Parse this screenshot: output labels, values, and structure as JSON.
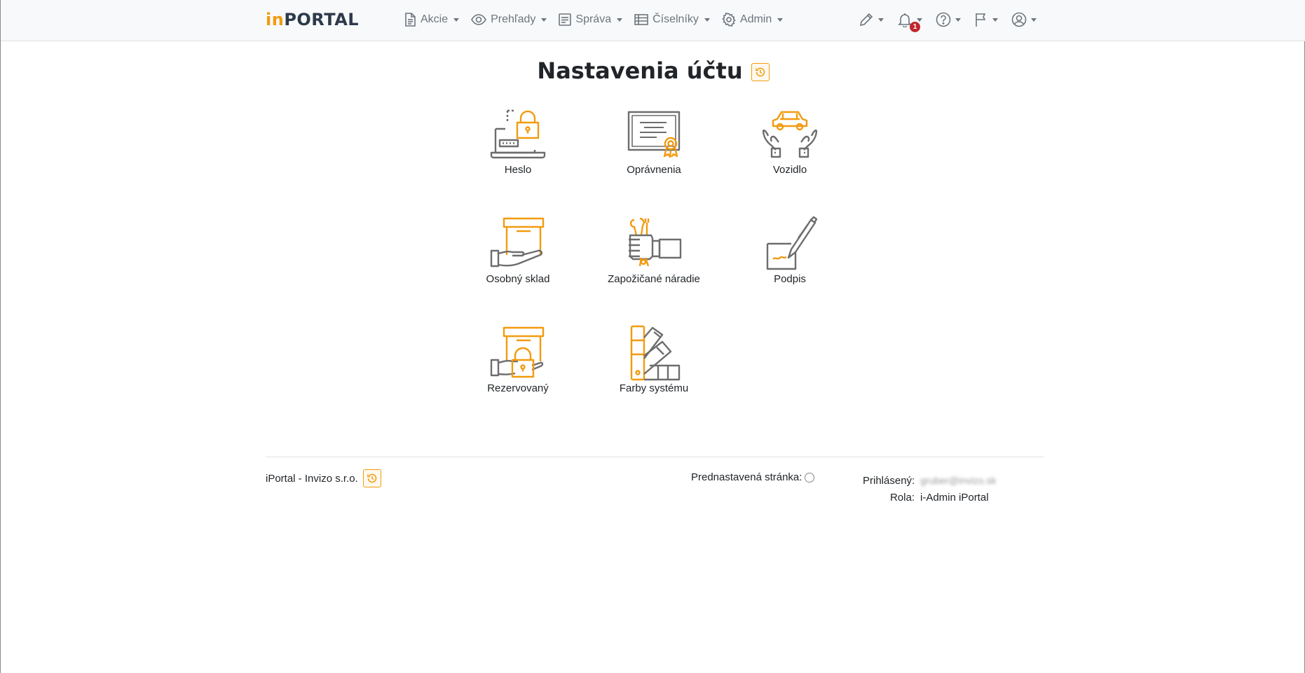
{
  "brand": {
    "prefix": "in",
    "suffix": "PORTAL"
  },
  "nav": {
    "items": [
      {
        "label": "Akcie",
        "icon": "document-icon"
      },
      {
        "label": "Prehľady",
        "icon": "eye-icon"
      },
      {
        "label": "Správa",
        "icon": "list-document-icon"
      },
      {
        "label": "Číselníky",
        "icon": "table-icon"
      },
      {
        "label": "Admin",
        "icon": "gear-icon"
      }
    ],
    "right": [
      {
        "icon": "pencil-icon"
      },
      {
        "icon": "bell-icon",
        "badge": "1"
      },
      {
        "icon": "help-icon"
      },
      {
        "icon": "flag-icon"
      },
      {
        "icon": "user-circle-icon"
      }
    ]
  },
  "page": {
    "title": "Nastavenia účtu"
  },
  "tiles": [
    {
      "label": "Heslo",
      "icon": "laptop-lock-icon"
    },
    {
      "label": "Oprávnenia",
      "icon": "certificate-icon"
    },
    {
      "label": "Vozidlo",
      "icon": "car-hands-icon"
    },
    {
      "label": "Osobný sklad",
      "icon": "box-hand-icon"
    },
    {
      "label": "Zapožičané náradie",
      "icon": "tools-hand-icon"
    },
    {
      "label": "Podpis",
      "icon": "pen-signature-icon"
    },
    {
      "label": "Rezervovaný",
      "icon": "box-lock-icon"
    },
    {
      "label": "Farby systému",
      "icon": "color-swatch-icon"
    }
  ],
  "footer": {
    "company": "iPortal - Invizo s.r.o.",
    "default_page_label": "Prednastavená stránka:",
    "logged_label": "Prihlásený:",
    "logged_value": "gruber@invizo.sk",
    "role_label": "Rola:",
    "role_value": "i-Admin iPortal"
  },
  "colors": {
    "accent": "#f29b0f",
    "icon_gray": "#6d6d6d",
    "badge": "#c0272d"
  }
}
